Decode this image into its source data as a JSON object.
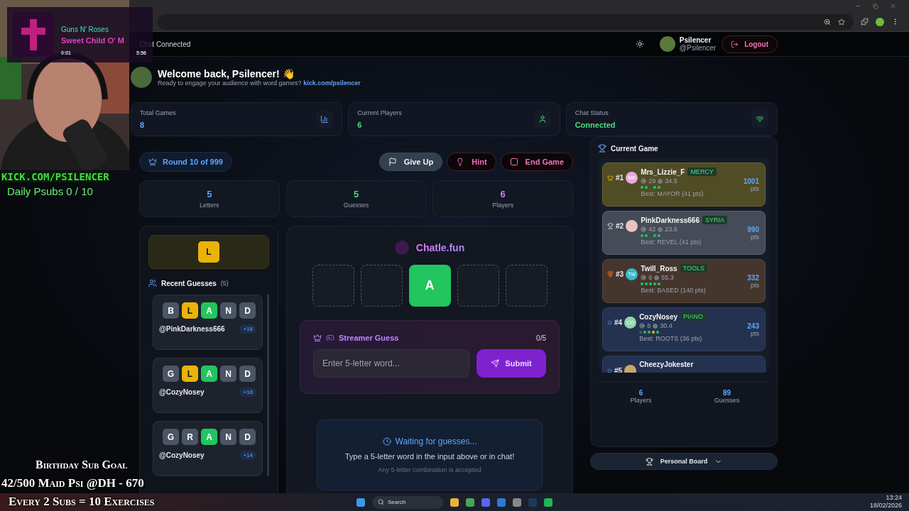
{
  "stream_overlay": {
    "song_artist": "Guns N' Roses",
    "song_title": "Sweet Child O' M",
    "elapsed": "0:01",
    "duration": "5:56",
    "channel": "KICK.COM/PSILENCER",
    "daily_subs": "Daily Psubs 0 / 10",
    "goal_lines": [
      "Birthday Sub Goal",
      "42/500 Maid Psi @DH - 670",
      "Every 2 Subs = 10 Exercises"
    ]
  },
  "header": {
    "chat_status": "Chat Connected",
    "user_name": "Psilencer",
    "user_handle": "@Psilencer",
    "logout": "Logout"
  },
  "welcome": {
    "title": "Welcome back, Psilencer! 👋",
    "subtitle": "Ready to engage your audience with word games?",
    "link": "kick.com/psilencer"
  },
  "stats": [
    {
      "label": "Total Games",
      "value": "8",
      "color": "#60a5fa",
      "kind": "chart"
    },
    {
      "label": "Current Players",
      "value": "6",
      "color": "#4ade80",
      "kind": "user"
    },
    {
      "label": "Chat Status",
      "value": "Connected",
      "color": "#4ade80",
      "kind": "wifi"
    }
  ],
  "round": {
    "label": "Round 10 of 999"
  },
  "actions": [
    {
      "label": "Give Up",
      "kind": "flag"
    },
    {
      "label": "Hint",
      "kind": "hint"
    },
    {
      "label": "End Game",
      "kind": "end"
    }
  ],
  "game_stats": [
    {
      "value": "5",
      "label": "Letters",
      "color": "#60a5fa"
    },
    {
      "value": "5",
      "label": "Guesses",
      "color": "#4ade80"
    },
    {
      "value": "6",
      "label": "Players",
      "color": "#c084fc"
    }
  ],
  "known_letters": [
    "L"
  ],
  "recent_guesses": {
    "title": "Recent Guesses",
    "count": "(5)",
    "items": [
      {
        "letters": [
          {
            "letter": "B",
            "kind": "absent"
          },
          {
            "letter": "L",
            "kind": "present"
          },
          {
            "letter": "A",
            "kind": "correct"
          },
          {
            "letter": "N",
            "kind": "absent"
          },
          {
            "letter": "D",
            "kind": "absent"
          }
        ],
        "user": "@PinkDarkness666",
        "points": "+18"
      },
      {
        "letters": [
          {
            "letter": "G",
            "kind": "absent"
          },
          {
            "letter": "L",
            "kind": "present"
          },
          {
            "letter": "A",
            "kind": "correct"
          },
          {
            "letter": "N",
            "kind": "absent"
          },
          {
            "letter": "D",
            "kind": "absent"
          }
        ],
        "user": "@CozyNosey",
        "points": "+18"
      },
      {
        "letters": [
          {
            "letter": "G",
            "kind": "absent"
          },
          {
            "letter": "R",
            "kind": "absent"
          },
          {
            "letter": "A",
            "kind": "correct"
          },
          {
            "letter": "N",
            "kind": "absent"
          },
          {
            "letter": "D",
            "kind": "absent"
          }
        ],
        "user": "@CozyNosey",
        "points": "+14"
      }
    ]
  },
  "board": {
    "title": "Chatle.fun",
    "tiles": [
      {
        "kind": "empty"
      },
      {
        "kind": "empty"
      },
      {
        "kind": "correct",
        "letter": "A"
      },
      {
        "kind": "empty"
      },
      {
        "kind": "empty"
      }
    ]
  },
  "streamer_guess": {
    "title": "Streamer Guess",
    "count": "0/5",
    "placeholder": "Enter 5-letter word...",
    "submit": "Submit"
  },
  "waiting": {
    "title": "Waiting for guesses...",
    "text": "Type a 5-letter word in the input above or in chat!",
    "note": "Any 5-letter combination is accepted"
  },
  "current_game": {
    "title": "Current Game",
    "players": [
      {
        "rank": "#1",
        "kind": "gold",
        "initials": "MR",
        "color": "#e9a8e0",
        "name": "Mrs_Lizzie_F",
        "word": "MERCY",
        "guesses": "29",
        "time": "34.5",
        "dots": [
          {
            "kind": "correct"
          },
          {
            "kind": "correct"
          },
          {
            "kind": "none"
          },
          {
            "kind": "correct"
          },
          {
            "kind": "correct"
          }
        ],
        "best": "Best: MAYOR (41 pts)",
        "points": "1001",
        "unit": "pts"
      },
      {
        "rank": "#2",
        "kind": "silver",
        "color": "#e8c4c4",
        "name": "PinkDarkness666",
        "word": "SYRIA",
        "guesses": "42",
        "time": "23.6",
        "dots": [
          {
            "kind": "correct"
          },
          {
            "kind": "correct"
          },
          {
            "kind": "none"
          },
          {
            "kind": "correct"
          },
          {
            "kind": "correct"
          }
        ],
        "best": "Best: REVEL (41 pts)",
        "points": "990",
        "unit": "pts"
      },
      {
        "rank": "#3",
        "kind": "bronze",
        "initials": "TW",
        "color": "#3ab8c8",
        "name": "Twill_Ross",
        "word": "TOOLS",
        "guesses": "6",
        "time": "55.3",
        "dots": [
          {
            "kind": "correct"
          },
          {
            "kind": "correct"
          },
          {
            "kind": "correct"
          },
          {
            "kind": "correct"
          },
          {
            "kind": "correct"
          }
        ],
        "best": "Best: BASED (140 pts)",
        "points": "332",
        "unit": "pts"
      },
      {
        "rank": "#4",
        "kind": "blue",
        "initials": "CO",
        "color": "#8fd6a8",
        "name": "CozyNosey",
        "word": "PIANO",
        "guesses": "8",
        "time": "30.4",
        "dots": [
          {
            "kind": "absent"
          },
          {
            "kind": "correct"
          },
          {
            "kind": "correct"
          },
          {
            "kind": "present"
          },
          {
            "kind": "correct"
          }
        ],
        "best": "Best: ROOTS (36 pts)",
        "points": "243",
        "unit": "pts"
      },
      {
        "rank": "#5",
        "kind": "blue",
        "color": "#c9a66b",
        "name": "CheezyJokester"
      }
    ],
    "totals": [
      {
        "value": "6",
        "label": "Players"
      },
      {
        "value": "89",
        "label": "Guesses"
      }
    ]
  },
  "personal_board": "Personal Board",
  "taskbar": {
    "search": "Search",
    "time": "13:24",
    "date": "18/02/2026"
  }
}
